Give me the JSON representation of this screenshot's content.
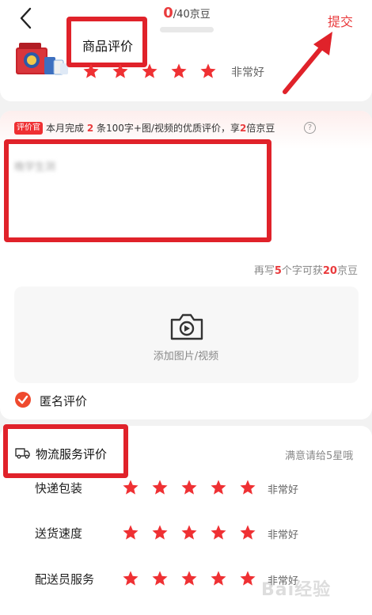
{
  "header": {
    "title": "商品评价",
    "submit_label": "提交",
    "progress_count": "0",
    "progress_total": "/40京豆",
    "progress_fraction": 0
  },
  "product": {
    "rating_text": "非常好",
    "stars": 5
  },
  "promo": {
    "badge": "评价官",
    "part1": "本月完成",
    "num1": "2",
    "part2": "条100字+图/视频的优质评价，享",
    "num2": "2",
    "part3": "倍京豆"
  },
  "review": {
    "placeholder": "晚学生测"
  },
  "hint": {
    "part1": "再写",
    "num1": "5",
    "part2": "个字可获",
    "num2": "20",
    "part3": "京豆"
  },
  "upload": {
    "label": "添加图片/视频"
  },
  "anonymous": {
    "label": "匿名评价"
  },
  "logistics": {
    "title": "物流服务评价",
    "hint": "满意请给5星哦",
    "items": [
      {
        "label": "快递包装",
        "rating_text": "非常好",
        "stars": 5
      },
      {
        "label": "送货速度",
        "rating_text": "非常好",
        "stars": 5
      },
      {
        "label": "配送员服务",
        "rating_text": "非常好",
        "stars": 5
      }
    ]
  },
  "watermark": "Bai经验",
  "colors": {
    "accent": "#e93b3d",
    "annotation_red": "#e0222a",
    "star": "#ef3033"
  }
}
